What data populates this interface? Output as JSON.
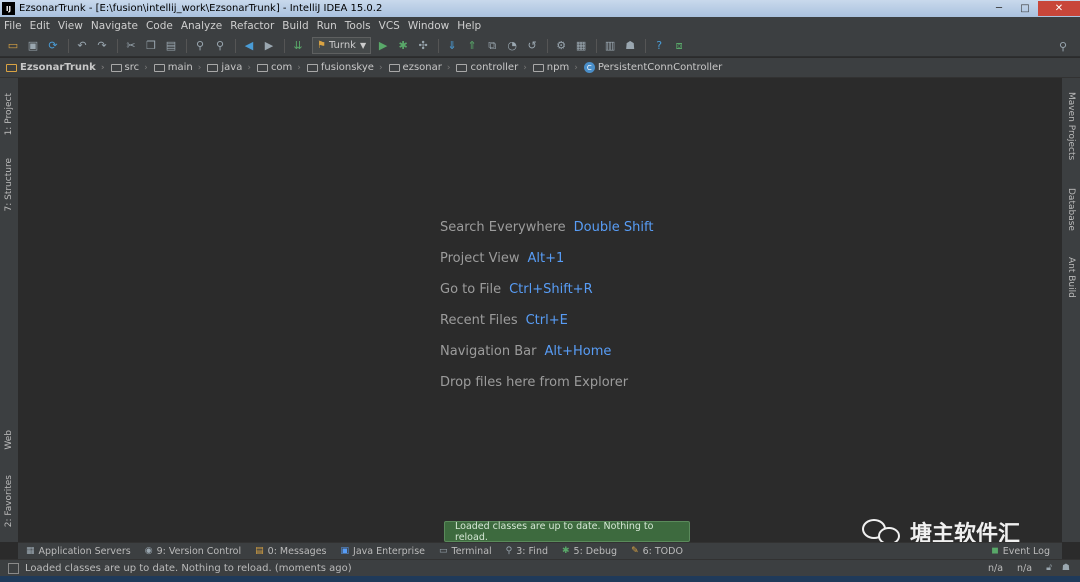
{
  "window": {
    "app_icon": "IJ",
    "title": "EzsonarTrunk - [E:\\fusion\\intellij_work\\EzsonarTrunk] - IntelliJ IDEA 15.0.2",
    "controls": {
      "minimize": "─",
      "maximize": "□",
      "close": "✕"
    }
  },
  "menu": [
    "File",
    "Edit",
    "View",
    "Navigate",
    "Code",
    "Analyze",
    "Refactor",
    "Build",
    "Run",
    "Tools",
    "VCS",
    "Window",
    "Help"
  ],
  "toolbar": {
    "run_config": "Turnk",
    "icons": [
      "open-icon",
      "save-icon",
      "sync-icon",
      "undo-icon",
      "redo-icon",
      "cut-icon",
      "copy-icon",
      "paste-icon",
      "find-icon",
      "replace-icon",
      "back-icon",
      "forward-icon",
      "make-icon",
      "run-icon",
      "debug-icon",
      "coverage-icon",
      "vcs-update-icon",
      "vcs-commit-icon",
      "vcs-compare-icon",
      "vcs-history-icon",
      "vcs-revert-icon",
      "settings-icon",
      "project-structure-icon",
      "sdk-icon",
      "android-icon",
      "help-icon",
      "jump-icon",
      "search-everywhere-icon"
    ]
  },
  "breadcrumbs": [
    "EzsonarTrunk",
    "src",
    "main",
    "java",
    "com",
    "fusionskye",
    "ezsonar",
    "controller",
    "npm",
    "PersistentConnController"
  ],
  "left_tabs": {
    "project": "1: Project",
    "structure": "7: Structure",
    "web": "Web",
    "favorites": "2: Favorites"
  },
  "right_tabs": {
    "maven": "Maven Projects",
    "database": "Database",
    "ant": "Ant Build"
  },
  "hints": [
    {
      "label": "Search Everywhere",
      "key": "Double Shift"
    },
    {
      "label": "Project View",
      "key": "Alt+1"
    },
    {
      "label": "Go to File",
      "key": "Ctrl+Shift+R"
    },
    {
      "label": "Recent Files",
      "key": "Ctrl+E"
    },
    {
      "label": "Navigation Bar",
      "key": "Alt+Home"
    },
    {
      "label": "Drop files here from Explorer",
      "key": ""
    }
  ],
  "balloon": "Loaded classes are up to date. Nothing to reload.",
  "watermark": "塘主软件汇",
  "tool_windows": {
    "app_servers": "Application Servers",
    "version_control": "9: Version Control",
    "messages": "0: Messages",
    "java_enterprise": "Java Enterprise",
    "terminal": "Terminal",
    "find": "3: Find",
    "debug": "5: Debug",
    "todo": "6: TODO",
    "event_log": "Event Log"
  },
  "status": {
    "message": "Loaded classes are up to date. Nothing to reload. (moments ago)",
    "pos1": "n/a",
    "pos2": "n/a"
  },
  "colors": {
    "editor_bg": "#2b2b2b",
    "panel_bg": "#3c3f41",
    "shortcut": "#589df6",
    "balloon_bg": "#3d6a3e"
  }
}
